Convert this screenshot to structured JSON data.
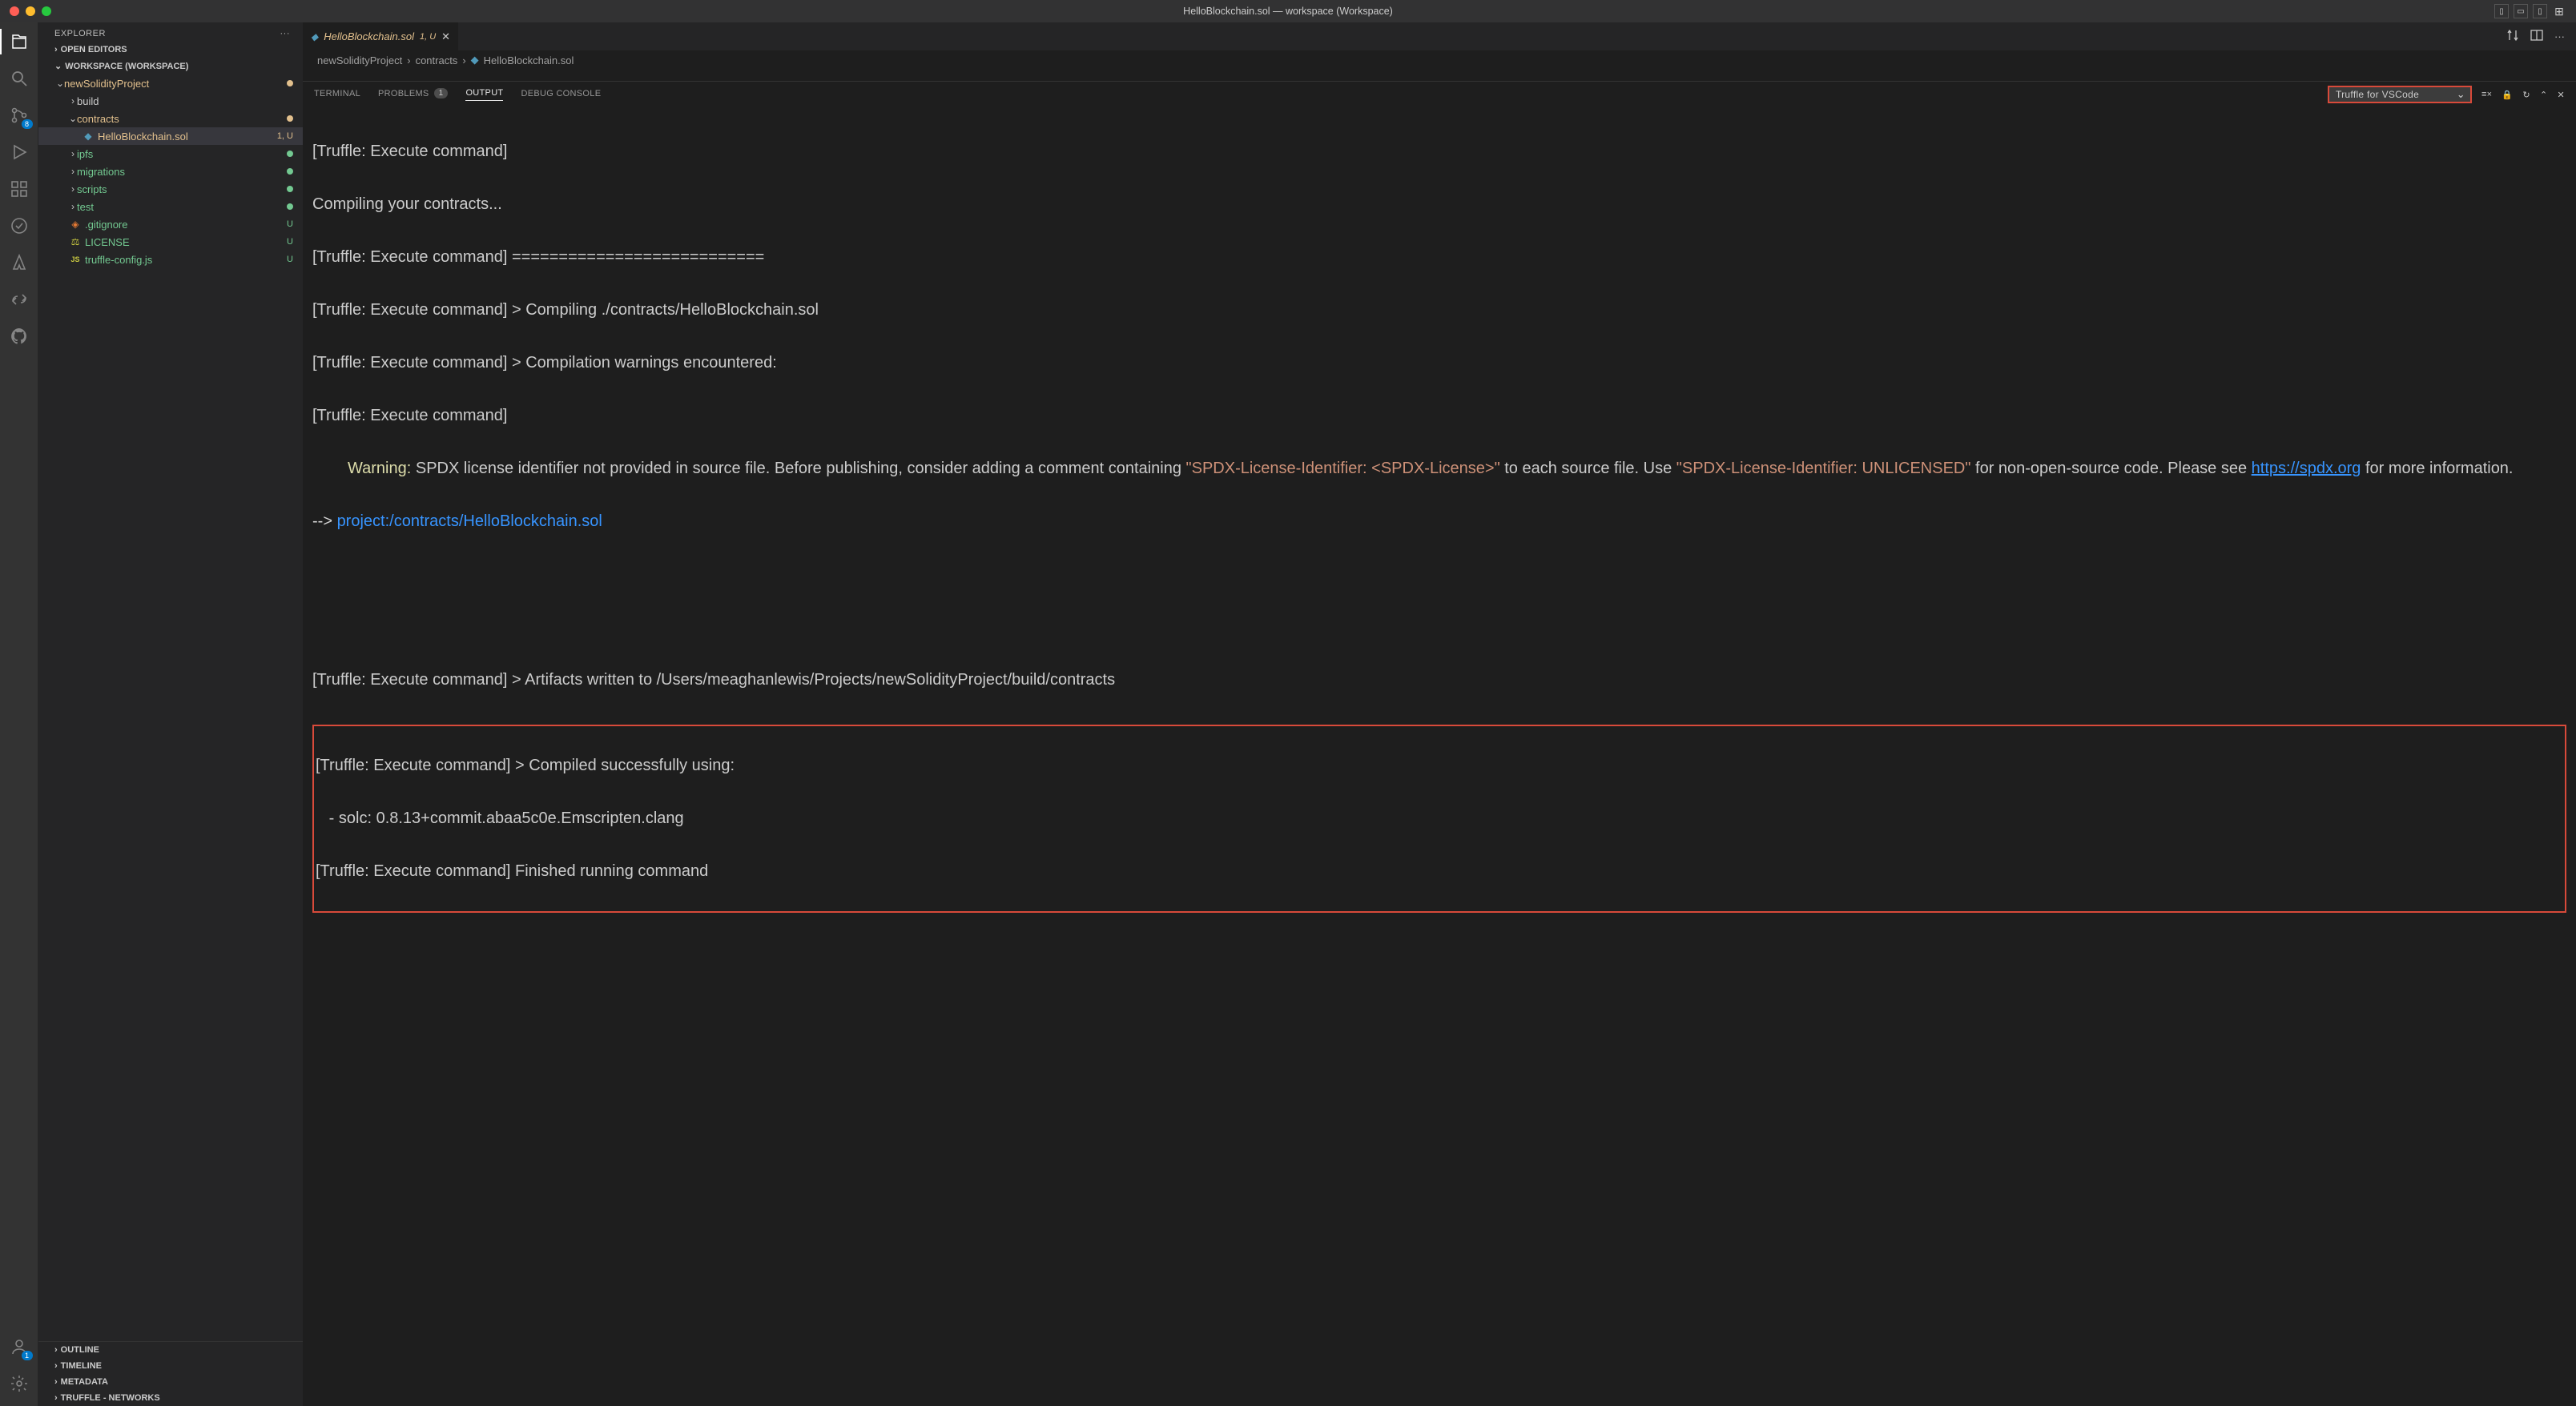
{
  "window": {
    "title": "HelloBlockchain.sol — workspace (Workspace)"
  },
  "activity": {
    "scm_badge": "8",
    "account_badge": "1"
  },
  "sidebar": {
    "title": "EXPLORER",
    "openEditors": "OPEN EDITORS",
    "workspace": "WORKSPACE (WORKSPACE)",
    "tree": {
      "project": "newSolidityProject",
      "build": "build",
      "contracts": "contracts",
      "file_hb": "HelloBlockchain.sol",
      "file_hb_status": "1, U",
      "ipfs": "ipfs",
      "migrations": "migrations",
      "scripts": "scripts",
      "test": "test",
      "gitignore": ".gitignore",
      "gitignore_status": "U",
      "license": "LICENSE",
      "license_status": "U",
      "truffle_cfg": "truffle-config.js",
      "truffle_cfg_status": "U"
    },
    "outline": "OUTLINE",
    "timeline": "TIMELINE",
    "metadata": "METADATA",
    "truffle_nets": "TRUFFLE - NETWORKS"
  },
  "tab": {
    "name": "HelloBlockchain.sol",
    "status": "1, U"
  },
  "breadcrumbs": {
    "p1": "newSolidityProject",
    "p2": "contracts",
    "p3": "HelloBlockchain.sol"
  },
  "panel": {
    "terminal": "TERMINAL",
    "problems": "PROBLEMS",
    "problems_count": "1",
    "output": "OUTPUT",
    "debug": "DEBUG CONSOLE",
    "dropdown": "Truffle for VSCode"
  },
  "output": {
    "l1": "[Truffle: Execute command]",
    "l2": "Compiling your contracts...",
    "l3": "[Truffle: Execute command] ===========================",
    "l4": "[Truffle: Execute command] > Compiling ./contracts/HelloBlockchain.sol",
    "l5": "[Truffle: Execute command] > Compilation warnings encountered:",
    "l6": "[Truffle: Execute command]",
    "warn_label": "Warning:",
    "warn_text_a": " SPDX license identifier not provided in source file. Before publishing, consider adding a comment containing ",
    "warn_str1": "\"SPDX-License-Identifier: <SPDX-License>\"",
    "warn_text_b": " to each source file. Use ",
    "warn_str2": "\"SPDX-License-Identifier: UNLICENSED\"",
    "warn_text_c": " for non-open-source code. Please see ",
    "warn_link": "https://spdx.org",
    "warn_text_d": " for more information.",
    "arrow": "--> ",
    "proj_path": "project:/contracts/HelloBlockchain.sol",
    "l_art": "[Truffle: Execute command] > Artifacts written to /Users/meaghanlewis/Projects/newSolidityProject/build/contracts",
    "l_succ": "[Truffle: Execute command] > Compiled successfully using:",
    "l_solc": "   - solc: 0.8.13+commit.abaa5c0e.Emscripten.clang",
    "l_fin": "[Truffle: Execute command] Finished running command"
  }
}
